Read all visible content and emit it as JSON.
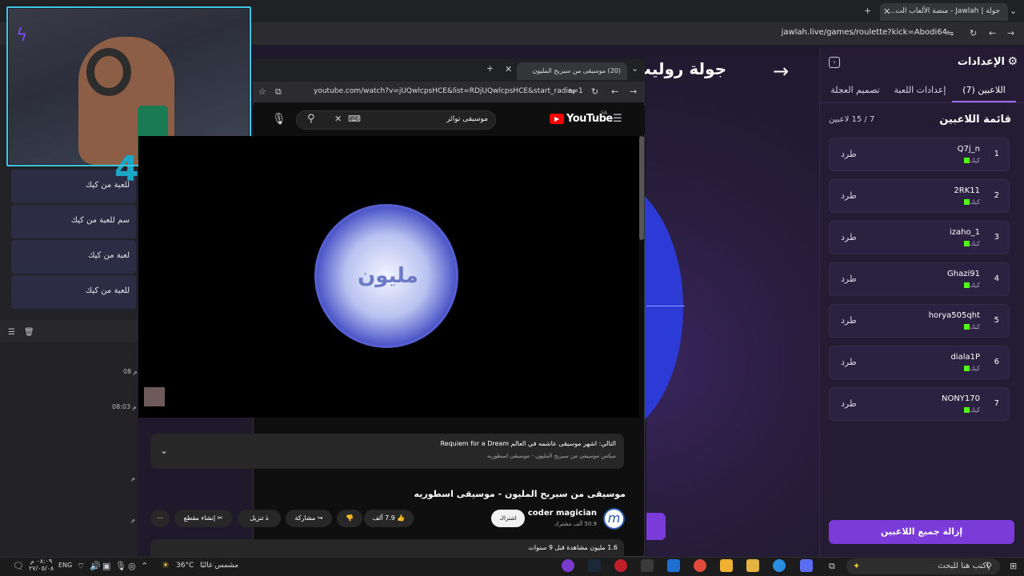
{
  "browser": {
    "tab_title": "جولة | Jawlah - منصة الألعاب الت...",
    "url": "jawlah.live/games/roulette?kick=Abodi64"
  },
  "roulette": {
    "title": "جولة روليت"
  },
  "settings": {
    "title": "الإعدادات",
    "tabs": [
      "اللاعبين (7)",
      "إعدادات اللعبة",
      "تصميم العجلة"
    ],
    "list_title": "قائمة اللاعبين",
    "count": "7 / 15 لاعبين",
    "kick_label": "طرد",
    "platform_label": "كيك",
    "players": [
      {
        "num": "1",
        "name": "Q7j_n"
      },
      {
        "num": "2",
        "name": "2RK11"
      },
      {
        "num": "3",
        "name": "izaho_1"
      },
      {
        "num": "4",
        "name": "Ghazi91"
      },
      {
        "num": "5",
        "name": "horya505qht"
      },
      {
        "num": "6",
        "name": "diala1P"
      },
      {
        "num": "7",
        "name": "NONY170"
      }
    ],
    "remove_all": "إزالة جميع اللاعبين",
    "accent_color": "#7b3bd8"
  },
  "left_panel": {
    "items": [
      "للعبة من كيك",
      "سم للعبة من كيك",
      "لعبة من كيك",
      "للعبة من كيك"
    ],
    "times": [
      "08 م",
      "08:03 م",
      "م",
      "م"
    ]
  },
  "youtube": {
    "tab_title": "(20) موسيقى من سيربح المليون",
    "url": "youtube.com/watch?v=jUQwlcpsHCE&list=RDjUQwlcpsHCE&start_radio=1",
    "search_value": "موسيقى توائر",
    "logo_text": "YouTube",
    "logo_region": "SA",
    "emblem_text": "مليون",
    "next_line1": "التالي: اشهر موسيقى عاشمه في العالم Requiem for a Dream",
    "next_line2": "ميكس موسيقى من سيربح المليون - موسيقى اسطوريه",
    "video_title": "موسيقى من سيربح المليون - موسيقى اسطوريه",
    "channel_name": "coder magician",
    "channel_subs": "50.9 ألف مشترك",
    "subscribe": "اشتراك",
    "likes": "7.9 ألف",
    "share": "مشاركة",
    "download": "تنزيل",
    "clip": "إنشاء مقطع",
    "views": "1.6 مليون مشاهدة قبل 9 سنوات"
  },
  "taskbar": {
    "search_placeholder": "اكتب هنا للبحث",
    "weather_temp": "36°C",
    "weather_desc": "مشمس غالبًا",
    "lang": "ENG",
    "time": "٠٨:٠٩ م",
    "date": "٢٧/٠٥/٠٨"
  }
}
